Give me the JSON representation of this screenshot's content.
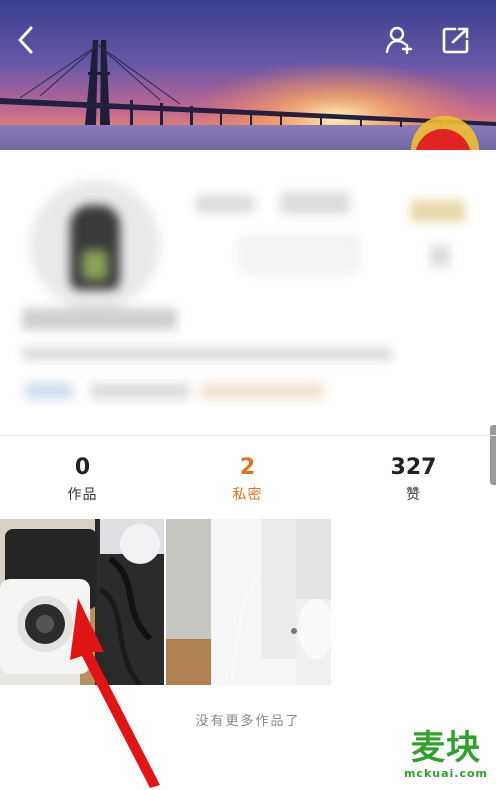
{
  "header": {
    "back_icon": "chevron-left-icon",
    "add_friend_icon": "add-user-icon",
    "share_icon": "share-icon"
  },
  "stats": [
    {
      "value": "0",
      "label": "作品"
    },
    {
      "value": "2",
      "label": "私密"
    },
    {
      "value": "327",
      "label": "赞"
    }
  ],
  "active_stat_color": "#e0721f",
  "footer": {
    "no_more": "没有更多作品了"
  },
  "watermark": {
    "logo": "麦块",
    "url": "mckuai.com"
  }
}
